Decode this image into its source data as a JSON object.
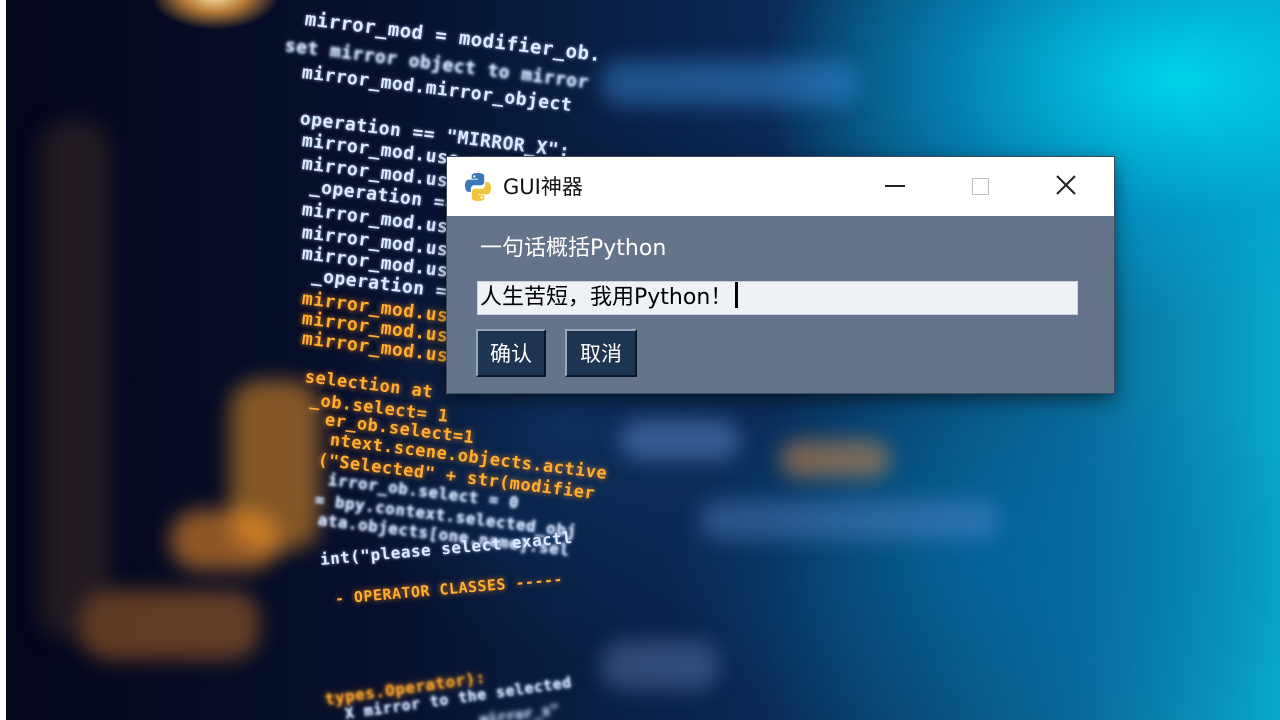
{
  "background": {
    "code_lines": [
      "mirror_mod = modifier_ob.",
      "set mirror object to mirror",
      "mirror_mod.mirror_object",
      "operation == \"MIRROR_X\":",
      "mirror_mod.use_x = True",
      "mirror_mod.us",
      "_operation ==",
      "mirror_mod.us",
      "mirror_mod.us",
      "mirror_mod.us",
      "_operation ==",
      "mirror_mod.us",
      "mirror_mod.us",
      "mirror_mod.us",
      "selection at",
      "_ob.select= 1",
      "er_ob.select=1",
      "ntext.scene.objects.active",
      "(\"Selected\" + str(modifier",
      "irror_ob.select = 0",
      "= bpy.context.selected_obj",
      "ata.objects[one.name].sel",
      "int(\"please select exactl",
      "- OPERATOR CLASSES -----",
      "types.Operator):",
      "X mirror to the selected",
      "mirror_x\""
    ]
  },
  "window": {
    "title": "GUI神器",
    "icon": "python-logo-icon",
    "controls": [
      "minimize-icon",
      "maximize-icon",
      "close-icon"
    ]
  },
  "form": {
    "label": "一句话概括Python",
    "input_value": "人生苦短，我用Python！",
    "confirm_label": "确认",
    "cancel_label": "取消"
  },
  "colors": {
    "dialog_bg": "#64748a",
    "button_bg": "#1e3552",
    "input_bg": "#eef1f5",
    "code_white": "#dfe9ff",
    "code_orange": "#ffae32"
  }
}
